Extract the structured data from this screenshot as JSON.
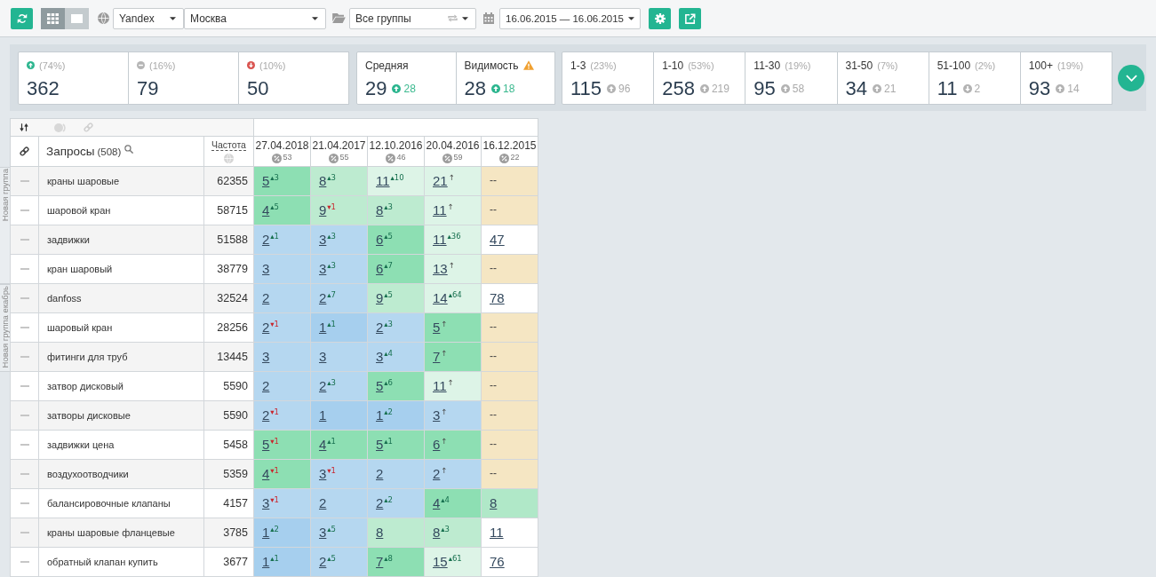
{
  "toolbar": {
    "view_modes": [
      {
        "kind": "grid",
        "selected": true
      },
      {
        "kind": "single",
        "selected": false
      }
    ],
    "search_engine": "Yandex",
    "region": "Москва",
    "group_filter": "Все группы",
    "date_range": "16.06.2015 — 16.06.2015"
  },
  "summary": {
    "movement": [
      {
        "kind": "up",
        "percent": "(74%)",
        "value": "362"
      },
      {
        "kind": "same",
        "percent": "(16%)",
        "value": "79"
      },
      {
        "kind": "down",
        "percent": "(10%)",
        "value": "50"
      }
    ],
    "averages": [
      {
        "label": "Средняя",
        "warning": false,
        "value": "29",
        "change": "28",
        "rising": true
      },
      {
        "label": "Видимость",
        "warning": true,
        "value": "28",
        "change": "18",
        "rising": true
      }
    ],
    "ranges": [
      {
        "label": "1-3",
        "percent": "(23%)",
        "value": "115",
        "change": "96",
        "rising": true
      },
      {
        "label": "1-10",
        "percent": "(53%)",
        "value": "258",
        "change": "219",
        "rising": true
      },
      {
        "label": "11-30",
        "percent": "(19%)",
        "value": "95",
        "change": "58",
        "rising": true
      },
      {
        "label": "31-50",
        "percent": "(7%)",
        "value": "34",
        "change": "21",
        "rising": true
      },
      {
        "label": "51-100",
        "percent": "(2%)",
        "value": "11",
        "change": "2",
        "rising": false
      },
      {
        "label": "100+",
        "percent": "(19%)",
        "value": "93",
        "change": "14",
        "rising": true
      }
    ]
  },
  "table": {
    "query_header": {
      "label": "Запросы",
      "count": "(508)"
    },
    "frequency_header": "Частота",
    "dates": [
      {
        "label": "27.04.2018",
        "count": "53"
      },
      {
        "label": "21.04.2017",
        "count": "55"
      },
      {
        "label": "12.10.2016",
        "count": "46"
      },
      {
        "label": "20.04.2016",
        "count": "59"
      },
      {
        "label": "16.12.2015",
        "count": "22"
      }
    ],
    "groups": [
      {
        "label": "Новая группа",
        "rows": [
          {
            "query": "краны шаровые",
            "freq": "62355",
            "cells": [
              {
                "kind": "rank",
                "value": "5",
                "delta": {
                  "kind": "rise",
                  "text": "▴3"
                },
                "color": "#8ddfb3"
              },
              {
                "kind": "rank",
                "value": "8",
                "delta": {
                  "kind": "rise",
                  "text": "▴3"
                },
                "color": "#bdebd0"
              },
              {
                "kind": "rank",
                "value": "11",
                "delta": {
                  "kind": "rise",
                  "text": "▴10"
                },
                "color": "#ddf4e7"
              },
              {
                "kind": "rank",
                "value": "21",
                "delta": {
                  "kind": "new",
                  "text": "↑"
                },
                "color": "#ddf4e7"
              },
              {
                "kind": "none",
                "value": "--",
                "color": "#f5e6c3"
              }
            ]
          },
          {
            "query": "шаровой кран",
            "freq": "58715",
            "cells": [
              {
                "kind": "rank",
                "value": "4",
                "delta": {
                  "kind": "rise",
                  "text": "▴5"
                },
                "color": "#8ddfb3"
              },
              {
                "kind": "rank",
                "value": "9",
                "delta": {
                  "kind": "fall",
                  "text": "▾1"
                },
                "color": "#bdebd0"
              },
              {
                "kind": "rank",
                "value": "8",
                "delta": {
                  "kind": "rise",
                  "text": "▴3"
                },
                "color": "#bdebd0"
              },
              {
                "kind": "rank",
                "value": "11",
                "delta": {
                  "kind": "new",
                  "text": "↑"
                },
                "color": "#ddf4e7"
              },
              {
                "kind": "none",
                "value": "--",
                "color": "#f5e6c3"
              }
            ]
          },
          {
            "query": "задвижки",
            "freq": "51588",
            "cells": [
              {
                "kind": "rank",
                "value": "2",
                "delta": {
                  "kind": "rise",
                  "text": "▴1"
                },
                "color": "#b5d7f0"
              },
              {
                "kind": "rank",
                "value": "3",
                "delta": {
                  "kind": "rise",
                  "text": "▴3"
                },
                "color": "#b5d7f0"
              },
              {
                "kind": "rank",
                "value": "6",
                "delta": {
                  "kind": "rise",
                  "text": "▴5"
                },
                "color": "#8ddfb3"
              },
              {
                "kind": "rank",
                "value": "11",
                "delta": {
                  "kind": "rise",
                  "text": "▴36"
                },
                "color": "#ddf4e7"
              },
              {
                "kind": "rank",
                "value": "47",
                "color": "#ffffff"
              }
            ]
          },
          {
            "query": "кран шаровый",
            "freq": "38779",
            "cells": [
              {
                "kind": "rank",
                "value": "3",
                "color": "#b5d7f0"
              },
              {
                "kind": "rank",
                "value": "3",
                "delta": {
                  "kind": "rise",
                  "text": "▴3"
                },
                "color": "#b5d7f0"
              },
              {
                "kind": "rank",
                "value": "6",
                "delta": {
                  "kind": "rise",
                  "text": "▴7"
                },
                "color": "#8ddfb3"
              },
              {
                "kind": "rank",
                "value": "13",
                "delta": {
                  "kind": "new",
                  "text": "↑"
                },
                "color": "#ddf4e7"
              },
              {
                "kind": "none",
                "value": "--",
                "color": "#f5e6c3"
              }
            ]
          }
        ]
      },
      {
        "label": "Новая группа екабрь",
        "rows": [
          {
            "query": "danfoss",
            "freq": "32524",
            "cells": [
              {
                "kind": "rank",
                "value": "2",
                "color": "#b5d7f0"
              },
              {
                "kind": "rank",
                "value": "2",
                "delta": {
                  "kind": "rise",
                  "text": "▴7"
                },
                "color": "#b5d7f0"
              },
              {
                "kind": "rank",
                "value": "9",
                "delta": {
                  "kind": "rise",
                  "text": "▴5"
                },
                "color": "#bdebd0"
              },
              {
                "kind": "rank",
                "value": "14",
                "delta": {
                  "kind": "rise",
                  "text": "▴64"
                },
                "color": "#ddf4e7"
              },
              {
                "kind": "rank",
                "value": "78",
                "color": "#ffffff"
              }
            ]
          },
          {
            "query": "шаровый кран",
            "freq": "28256",
            "cells": [
              {
                "kind": "rank",
                "value": "2",
                "delta": {
                  "kind": "fall",
                  "text": "▾1"
                },
                "color": "#b5d7f0"
              },
              {
                "kind": "rank",
                "value": "1",
                "delta": {
                  "kind": "rise",
                  "text": "▴1"
                },
                "color": "#a6cfee"
              },
              {
                "kind": "rank",
                "value": "2",
                "delta": {
                  "kind": "rise",
                  "text": "▴3"
                },
                "color": "#b5d7f0"
              },
              {
                "kind": "rank",
                "value": "5",
                "delta": {
                  "kind": "new",
                  "text": "↑"
                },
                "color": "#8ddfb3"
              },
              {
                "kind": "none",
                "value": "--",
                "color": "#f5e6c3"
              }
            ]
          },
          {
            "query": "фитинги для труб",
            "freq": "13445",
            "cells": [
              {
                "kind": "rank",
                "value": "3",
                "color": "#b5d7f0"
              },
              {
                "kind": "rank",
                "value": "3",
                "color": "#b5d7f0"
              },
              {
                "kind": "rank",
                "value": "3",
                "delta": {
                  "kind": "rise",
                  "text": "▴4"
                },
                "color": "#b5d7f0"
              },
              {
                "kind": "rank",
                "value": "7",
                "delta": {
                  "kind": "new",
                  "text": "↑"
                },
                "color": "#8ddfb3"
              },
              {
                "kind": "none",
                "value": "--",
                "color": "#f5e6c3"
              }
            ]
          }
        ]
      },
      {
        "rows": [
          {
            "query": "затвор дисковый",
            "freq": "5590",
            "cells": [
              {
                "kind": "rank",
                "value": "2",
                "color": "#b5d7f0"
              },
              {
                "kind": "rank",
                "value": "2",
                "delta": {
                  "kind": "rise",
                  "text": "▴3"
                },
                "color": "#b5d7f0"
              },
              {
                "kind": "rank",
                "value": "5",
                "delta": {
                  "kind": "rise",
                  "text": "▴6"
                },
                "color": "#8ddfb3"
              },
              {
                "kind": "rank",
                "value": "11",
                "delta": {
                  "kind": "new",
                  "text": "↑"
                },
                "color": "#ddf4e7"
              },
              {
                "kind": "none",
                "value": "--",
                "color": "#f5e6c3"
              }
            ]
          },
          {
            "query": "затворы дисковые",
            "freq": "5590",
            "cells": [
              {
                "kind": "rank",
                "value": "2",
                "delta": {
                  "kind": "fall",
                  "text": "▾1"
                },
                "color": "#b5d7f0"
              },
              {
                "kind": "rank",
                "value": "1",
                "color": "#a6cfee"
              },
              {
                "kind": "rank",
                "value": "1",
                "delta": {
                  "kind": "rise",
                  "text": "▴2"
                },
                "color": "#a6cfee"
              },
              {
                "kind": "rank",
                "value": "3",
                "delta": {
                  "kind": "new",
                  "text": "↑"
                },
                "color": "#b5d7f0"
              },
              {
                "kind": "none",
                "value": "--",
                "color": "#f5e6c3"
              }
            ]
          },
          {
            "query": "задвижки цена",
            "freq": "5458",
            "cells": [
              {
                "kind": "rank",
                "value": "5",
                "delta": {
                  "kind": "fall",
                  "text": "▾1"
                },
                "color": "#8ddfb3"
              },
              {
                "kind": "rank",
                "value": "4",
                "delta": {
                  "kind": "rise",
                  "text": "▴1"
                },
                "color": "#8ddfb3"
              },
              {
                "kind": "rank",
                "value": "5",
                "delta": {
                  "kind": "rise",
                  "text": "▴1"
                },
                "color": "#8ddfb3"
              },
              {
                "kind": "rank",
                "value": "6",
                "delta": {
                  "kind": "new",
                  "text": "↑"
                },
                "color": "#8ddfb3"
              },
              {
                "kind": "none",
                "value": "--",
                "color": "#f5e6c3"
              }
            ]
          },
          {
            "query": "воздухоотводчики",
            "freq": "5359",
            "cells": [
              {
                "kind": "rank",
                "value": "4",
                "delta": {
                  "kind": "fall",
                  "text": "▾1"
                },
                "color": "#8ddfb3"
              },
              {
                "kind": "rank",
                "value": "3",
                "delta": {
                  "kind": "fall",
                  "text": "▾1"
                },
                "color": "#b5d7f0"
              },
              {
                "kind": "rank",
                "value": "2",
                "color": "#b5d7f0"
              },
              {
                "kind": "rank",
                "value": "2",
                "delta": {
                  "kind": "new",
                  "text": "↑"
                },
                "color": "#b5d7f0"
              },
              {
                "kind": "none",
                "value": "--",
                "color": "#f5e6c3"
              }
            ]
          },
          {
            "query": "балансировочные клапаны",
            "freq": "4157",
            "cells": [
              {
                "kind": "rank",
                "value": "3",
                "delta": {
                  "kind": "fall",
                  "text": "▾1"
                },
                "color": "#b5d7f0"
              },
              {
                "kind": "rank",
                "value": "2",
                "color": "#b5d7f0"
              },
              {
                "kind": "rank",
                "value": "2",
                "delta": {
                  "kind": "rise",
                  "text": "▴2"
                },
                "color": "#b5d7f0"
              },
              {
                "kind": "rank",
                "value": "4",
                "delta": {
                  "kind": "rise",
                  "text": "▴4"
                },
                "color": "#8ddfb3"
              },
              {
                "kind": "rank",
                "value": "8",
                "color": "#b0e8c8"
              }
            ]
          },
          {
            "query": "краны шаровые фланцевые",
            "freq": "3785",
            "cells": [
              {
                "kind": "rank",
                "value": "1",
                "delta": {
                  "kind": "rise",
                  "text": "▴2"
                },
                "color": "#a6cfee"
              },
              {
                "kind": "rank",
                "value": "3",
                "delta": {
                  "kind": "rise",
                  "text": "▴5"
                },
                "color": "#b5d7f0"
              },
              {
                "kind": "rank",
                "value": "8",
                "color": "#bdebd0"
              },
              {
                "kind": "rank",
                "value": "8",
                "delta": {
                  "kind": "rise",
                  "text": "▴3"
                },
                "color": "#bdebd0"
              },
              {
                "kind": "rank",
                "value": "11",
                "color": "#ffffff"
              }
            ]
          },
          {
            "query": "обратный клапан купить",
            "freq": "3677",
            "cells": [
              {
                "kind": "rank",
                "value": "1",
                "delta": {
                  "kind": "rise",
                  "text": "▴1"
                },
                "color": "#a6cfee"
              },
              {
                "kind": "rank",
                "value": "2",
                "delta": {
                  "kind": "rise",
                  "text": "▴5"
                },
                "color": "#b5d7f0"
              },
              {
                "kind": "rank",
                "value": "7",
                "delta": {
                  "kind": "rise",
                  "text": "▴8"
                },
                "color": "#8ddfb3"
              },
              {
                "kind": "rank",
                "value": "15",
                "delta": {
                  "kind": "rise",
                  "text": "▴61"
                },
                "color": "#ddf4e7"
              },
              {
                "kind": "rank",
                "value": "76",
                "color": "#ffffff"
              }
            ]
          }
        ]
      }
    ]
  }
}
